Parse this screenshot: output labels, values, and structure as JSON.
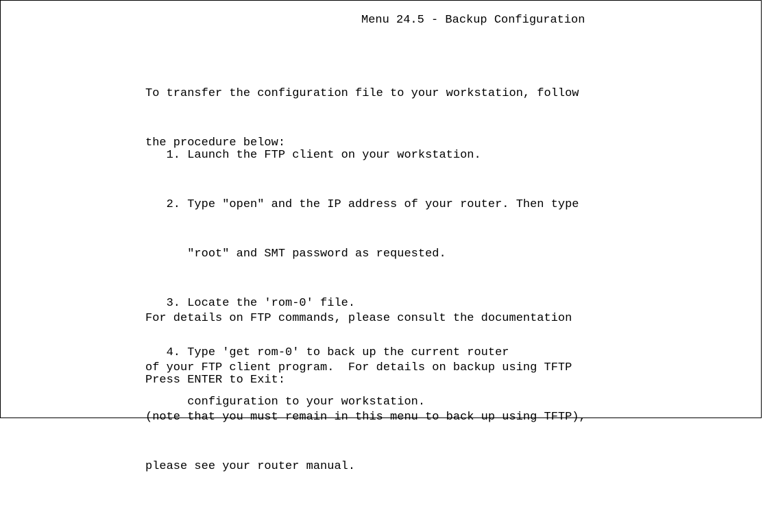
{
  "window": {
    "title": "Menu 24.5 - Backup Configuration"
  },
  "intro": {
    "line1": "To transfer the configuration file to your workstation, follow",
    "line2": "the procedure below:"
  },
  "steps": [
    {
      "line1": "   1. Launch the FTP client on your workstation."
    },
    {
      "line1": "   2. Type \"open\" and the IP address of your router. Then type",
      "line2": "      \"root\" and SMT password as requested."
    },
    {
      "line1": "   3. Locate the 'rom-0' file."
    },
    {
      "line1": "   4. Type 'get rom-0' to back up the current router",
      "line2": "      configuration to your workstation."
    }
  ],
  "details": {
    "line1": "For details on FTP commands, please consult the documentation",
    "line2": "of your FTP client program.  For details on backup using TFTP",
    "line3": "(note that you must remain in this menu to back up using TFTP),",
    "line4": "please see your router manual."
  },
  "prompt": {
    "label": "Press ENTER to Exit:"
  }
}
